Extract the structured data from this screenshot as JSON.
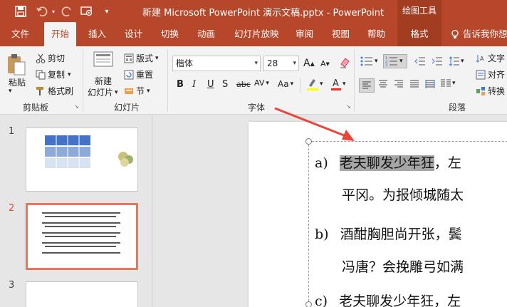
{
  "titlebar": {
    "title": "新建 Microsoft PowerPoint 演示文稿.pptx - PowerPoint",
    "context_tool": "绘图工具"
  },
  "tabs": [
    {
      "label": "文件"
    },
    {
      "label": "开始"
    },
    {
      "label": "插入"
    },
    {
      "label": "设计"
    },
    {
      "label": "切换"
    },
    {
      "label": "动画"
    },
    {
      "label": "幻灯片放映"
    },
    {
      "label": "审阅"
    },
    {
      "label": "视图"
    },
    {
      "label": "帮助"
    },
    {
      "label": "格式"
    }
  ],
  "tellme": "告诉我你想",
  "clipboard": {
    "paste": "粘贴",
    "cut": "剪切",
    "copy": "复制",
    "format_painter": "格式刷",
    "group": "剪贴板"
  },
  "slides_group": {
    "new_slide_1": "新建",
    "new_slide_2": "幻灯片",
    "layout": "版式",
    "reset": "重置",
    "section": "节",
    "group": "幻灯片"
  },
  "font": {
    "name": "楷体",
    "size": "28",
    "bold": "B",
    "italic": "I",
    "underline": "U",
    "strike": "S",
    "spacing_label": "abc",
    "case_label": "Aa",
    "grow": "A",
    "shrink": "A",
    "group": "字体"
  },
  "paragraph": {
    "group": "段落",
    "text_direction": "文字",
    "align_text": "对齐",
    "convert": "转换"
  },
  "thumbnails": [
    {
      "num": "1"
    },
    {
      "num": "2"
    },
    {
      "num": "3"
    }
  ],
  "slide_text": {
    "l1_label": "a)",
    "l1_hl": "老夫聊发少年狂",
    "l1_rest": "，左",
    "l2": "平冈。为报倾城随太",
    "l3_label": "b)",
    "l3": "酒酣胸胆尚开张，鬓",
    "l4": "冯唐？会挽雕弓如满",
    "l5_label": "c)",
    "l5": "老夫聊发少年狂，左"
  },
  "colors": {
    "accent": "#b7472a",
    "highlight": "#a6a6a6",
    "arrow": "#e8463a"
  }
}
